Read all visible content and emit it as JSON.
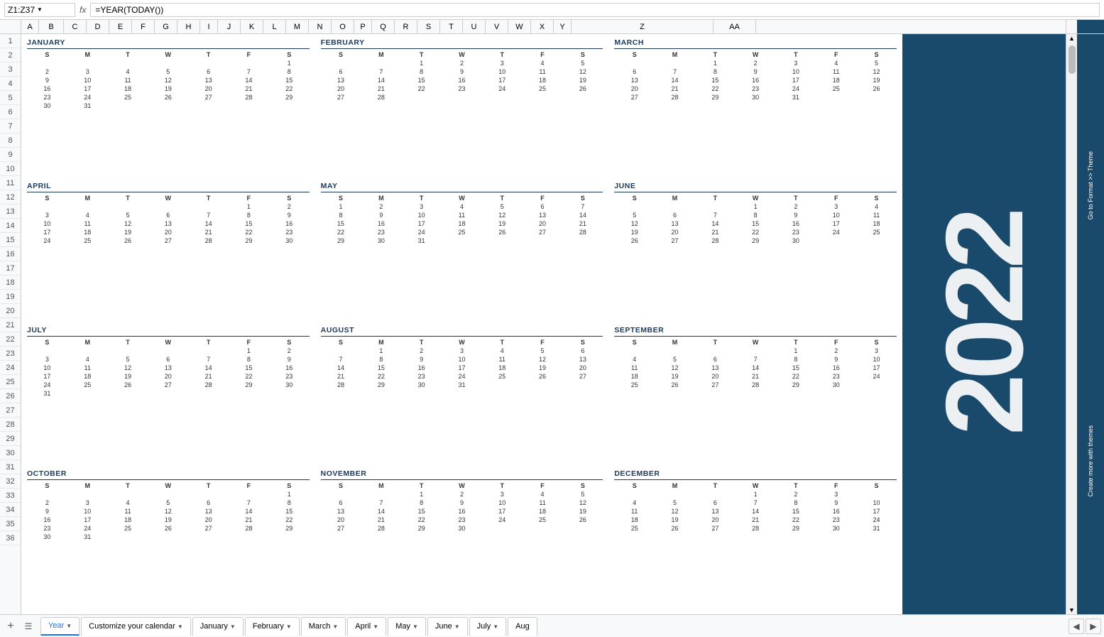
{
  "topbar": {
    "cell_ref": "Z1:Z37",
    "fx_label": "fx",
    "formula": "=YEAR(TODAY())"
  },
  "year": "2022",
  "sidebar_go": "Go to  Format >> Theme",
  "sidebar_create": "Create more with themes",
  "columns": [
    "A",
    "B",
    "C",
    "D",
    "E",
    "F",
    "G",
    "H",
    "I",
    "J",
    "K",
    "L",
    "M",
    "N",
    "O",
    "P",
    "Q",
    "R",
    "S",
    "T",
    "U",
    "V",
    "W",
    "X",
    "Y",
    "Z",
    "AA"
  ],
  "months": [
    {
      "name": "JANUARY",
      "headers": [
        "S",
        "M",
        "T",
        "W",
        "T",
        "F",
        "S"
      ],
      "weeks": [
        [
          "",
          "",
          "",
          "",
          "",
          "",
          "1"
        ],
        [
          "2",
          "3",
          "4",
          "5",
          "6",
          "7",
          "8"
        ],
        [
          "9",
          "10",
          "11",
          "12",
          "13",
          "14",
          "15"
        ],
        [
          "16",
          "17",
          "18",
          "19",
          "20",
          "21",
          "22"
        ],
        [
          "23",
          "24",
          "25",
          "26",
          "27",
          "28",
          "29"
        ],
        [
          "30",
          "31",
          "",
          "",
          "",
          "",
          ""
        ]
      ]
    },
    {
      "name": "FEBRUARY",
      "headers": [
        "S",
        "M",
        "T",
        "W",
        "T",
        "F",
        "S"
      ],
      "weeks": [
        [
          "",
          "",
          "1",
          "2",
          "3",
          "4",
          "5"
        ],
        [
          "6",
          "7",
          "8",
          "9",
          "10",
          "11",
          "12"
        ],
        [
          "13",
          "14",
          "15",
          "16",
          "17",
          "18",
          "19"
        ],
        [
          "20",
          "21",
          "22",
          "23",
          "24",
          "25",
          "26"
        ],
        [
          "27",
          "28",
          "",
          "",
          "",
          "",
          ""
        ]
      ]
    },
    {
      "name": "MARCH",
      "headers": [
        "S",
        "M",
        "T",
        "W",
        "T",
        "F",
        "S"
      ],
      "weeks": [
        [
          "",
          "",
          "1",
          "2",
          "3",
          "4",
          "5"
        ],
        [
          "6",
          "7",
          "8",
          "9",
          "10",
          "11",
          "12"
        ],
        [
          "13",
          "14",
          "15",
          "16",
          "17",
          "18",
          "19"
        ],
        [
          "20",
          "21",
          "22",
          "23",
          "24",
          "25",
          "26"
        ],
        [
          "27",
          "28",
          "29",
          "30",
          "31",
          "",
          ""
        ]
      ]
    },
    {
      "name": "APRIL",
      "headers": [
        "S",
        "M",
        "T",
        "W",
        "T",
        "F",
        "S"
      ],
      "weeks": [
        [
          "",
          "",
          "",
          "",
          "",
          "1",
          "2"
        ],
        [
          "3",
          "4",
          "5",
          "6",
          "7",
          "8",
          "9"
        ],
        [
          "10",
          "11",
          "12",
          "13",
          "14",
          "15",
          "16"
        ],
        [
          "17",
          "18",
          "19",
          "20",
          "21",
          "22",
          "23"
        ],
        [
          "24",
          "25",
          "26",
          "27",
          "28",
          "29",
          "30"
        ]
      ]
    },
    {
      "name": "MAY",
      "headers": [
        "S",
        "M",
        "T",
        "W",
        "T",
        "F",
        "S"
      ],
      "weeks": [
        [
          "1",
          "2",
          "3",
          "4",
          "5",
          "6",
          "7"
        ],
        [
          "8",
          "9",
          "10",
          "11",
          "12",
          "13",
          "14"
        ],
        [
          "15",
          "16",
          "17",
          "18",
          "19",
          "20",
          "21"
        ],
        [
          "22",
          "23",
          "24",
          "25",
          "26",
          "27",
          "28"
        ],
        [
          "29",
          "30",
          "31",
          "",
          "",
          "",
          ""
        ]
      ]
    },
    {
      "name": "JUNE",
      "headers": [
        "S",
        "M",
        "T",
        "W",
        "T",
        "F",
        "S"
      ],
      "weeks": [
        [
          "",
          "",
          "",
          "1",
          "2",
          "3",
          "4"
        ],
        [
          "5",
          "6",
          "7",
          "8",
          "9",
          "10",
          "11"
        ],
        [
          "12",
          "13",
          "14",
          "15",
          "16",
          "17",
          "18"
        ],
        [
          "19",
          "20",
          "21",
          "22",
          "23",
          "24",
          "25"
        ],
        [
          "26",
          "27",
          "28",
          "29",
          "30",
          "",
          ""
        ]
      ]
    },
    {
      "name": "JULY",
      "headers": [
        "S",
        "M",
        "T",
        "W",
        "T",
        "F",
        "S"
      ],
      "weeks": [
        [
          "",
          "",
          "",
          "",
          "",
          "1",
          "2"
        ],
        [
          "3",
          "4",
          "5",
          "6",
          "7",
          "8",
          "9"
        ],
        [
          "10",
          "11",
          "12",
          "13",
          "14",
          "15",
          "16"
        ],
        [
          "17",
          "18",
          "19",
          "20",
          "21",
          "22",
          "23"
        ],
        [
          "24",
          "25",
          "26",
          "27",
          "28",
          "29",
          "30"
        ],
        [
          "31",
          "",
          "",
          "",
          "",
          "",
          ""
        ]
      ]
    },
    {
      "name": "AUGUST",
      "headers": [
        "S",
        "M",
        "T",
        "W",
        "T",
        "F",
        "S"
      ],
      "weeks": [
        [
          "",
          "1",
          "2",
          "3",
          "4",
          "5",
          "6"
        ],
        [
          "7",
          "8",
          "9",
          "10",
          "11",
          "12",
          "13"
        ],
        [
          "14",
          "15",
          "16",
          "17",
          "18",
          "19",
          "20"
        ],
        [
          "21",
          "22",
          "23",
          "24",
          "25",
          "26",
          "27"
        ],
        [
          "28",
          "29",
          "30",
          "31",
          "",
          "",
          ""
        ]
      ]
    },
    {
      "name": "SEPTEMBER",
      "headers": [
        "S",
        "M",
        "T",
        "W",
        "T",
        "F",
        "S"
      ],
      "weeks": [
        [
          "",
          "",
          "",
          "",
          "1",
          "2",
          "3"
        ],
        [
          "4",
          "5",
          "6",
          "7",
          "8",
          "9",
          "10"
        ],
        [
          "11",
          "12",
          "13",
          "14",
          "15",
          "16",
          "17"
        ],
        [
          "18",
          "19",
          "20",
          "21",
          "22",
          "23",
          "24"
        ],
        [
          "25",
          "26",
          "27",
          "28",
          "29",
          "30",
          ""
        ]
      ]
    },
    {
      "name": "OCTOBER",
      "headers": [
        "S",
        "M",
        "T",
        "W",
        "T",
        "F",
        "S"
      ],
      "weeks": [
        [
          "",
          "",
          "",
          "",
          "",
          "",
          "1"
        ],
        [
          "2",
          "3",
          "4",
          "5",
          "6",
          "7",
          "8"
        ],
        [
          "9",
          "10",
          "11",
          "12",
          "13",
          "14",
          "15"
        ],
        [
          "16",
          "17",
          "18",
          "19",
          "20",
          "21",
          "22"
        ],
        [
          "23",
          "24",
          "25",
          "26",
          "27",
          "28",
          "29"
        ],
        [
          "30",
          "31",
          "",
          "",
          "",
          "",
          ""
        ]
      ]
    },
    {
      "name": "NOVEMBER",
      "headers": [
        "S",
        "M",
        "T",
        "W",
        "T",
        "F",
        "S"
      ],
      "weeks": [
        [
          "",
          "",
          "1",
          "2",
          "3",
          "4",
          "5"
        ],
        [
          "6",
          "7",
          "8",
          "9",
          "10",
          "11",
          "12"
        ],
        [
          "13",
          "14",
          "15",
          "16",
          "17",
          "18",
          "19"
        ],
        [
          "20",
          "21",
          "22",
          "23",
          "24",
          "25",
          "26"
        ],
        [
          "27",
          "28",
          "29",
          "30",
          "",
          "",
          ""
        ]
      ]
    },
    {
      "name": "DECEMBER",
      "headers": [
        "S",
        "M",
        "T",
        "W",
        "T",
        "F",
        "S"
      ],
      "weeks": [
        [
          "",
          "",
          "",
          "1",
          "2",
          "3",
          ""
        ],
        [
          "4",
          "5",
          "6",
          "7",
          "8",
          "9",
          "10"
        ],
        [
          "11",
          "12",
          "13",
          "14",
          "15",
          "16",
          "17"
        ],
        [
          "18",
          "19",
          "20",
          "21",
          "22",
          "23",
          "24"
        ],
        [
          "25",
          "26",
          "27",
          "28",
          "29",
          "30",
          "31"
        ]
      ]
    }
  ],
  "tabs": [
    {
      "label": "Year",
      "active": true,
      "has_arrow": true
    },
    {
      "label": "Customize your calendar",
      "active": false,
      "has_arrow": true
    },
    {
      "label": "January",
      "active": false,
      "has_arrow": true
    },
    {
      "label": "February",
      "active": false,
      "has_arrow": true
    },
    {
      "label": "March",
      "active": false,
      "has_arrow": true
    },
    {
      "label": "April",
      "active": false,
      "has_arrow": true
    },
    {
      "label": "May",
      "active": false,
      "has_arrow": true
    },
    {
      "label": "June",
      "active": false,
      "has_arrow": true
    },
    {
      "label": "July",
      "active": false,
      "has_arrow": true
    },
    {
      "label": "Aug",
      "active": false,
      "has_arrow": false
    }
  ],
  "icons": {
    "add": "+",
    "sheets": "☰",
    "prev": "◀",
    "next": "▶",
    "star": "★",
    "refresh": "↻",
    "user": "👤",
    "maps": "🗺",
    "chat": "💬",
    "plus": "+"
  }
}
